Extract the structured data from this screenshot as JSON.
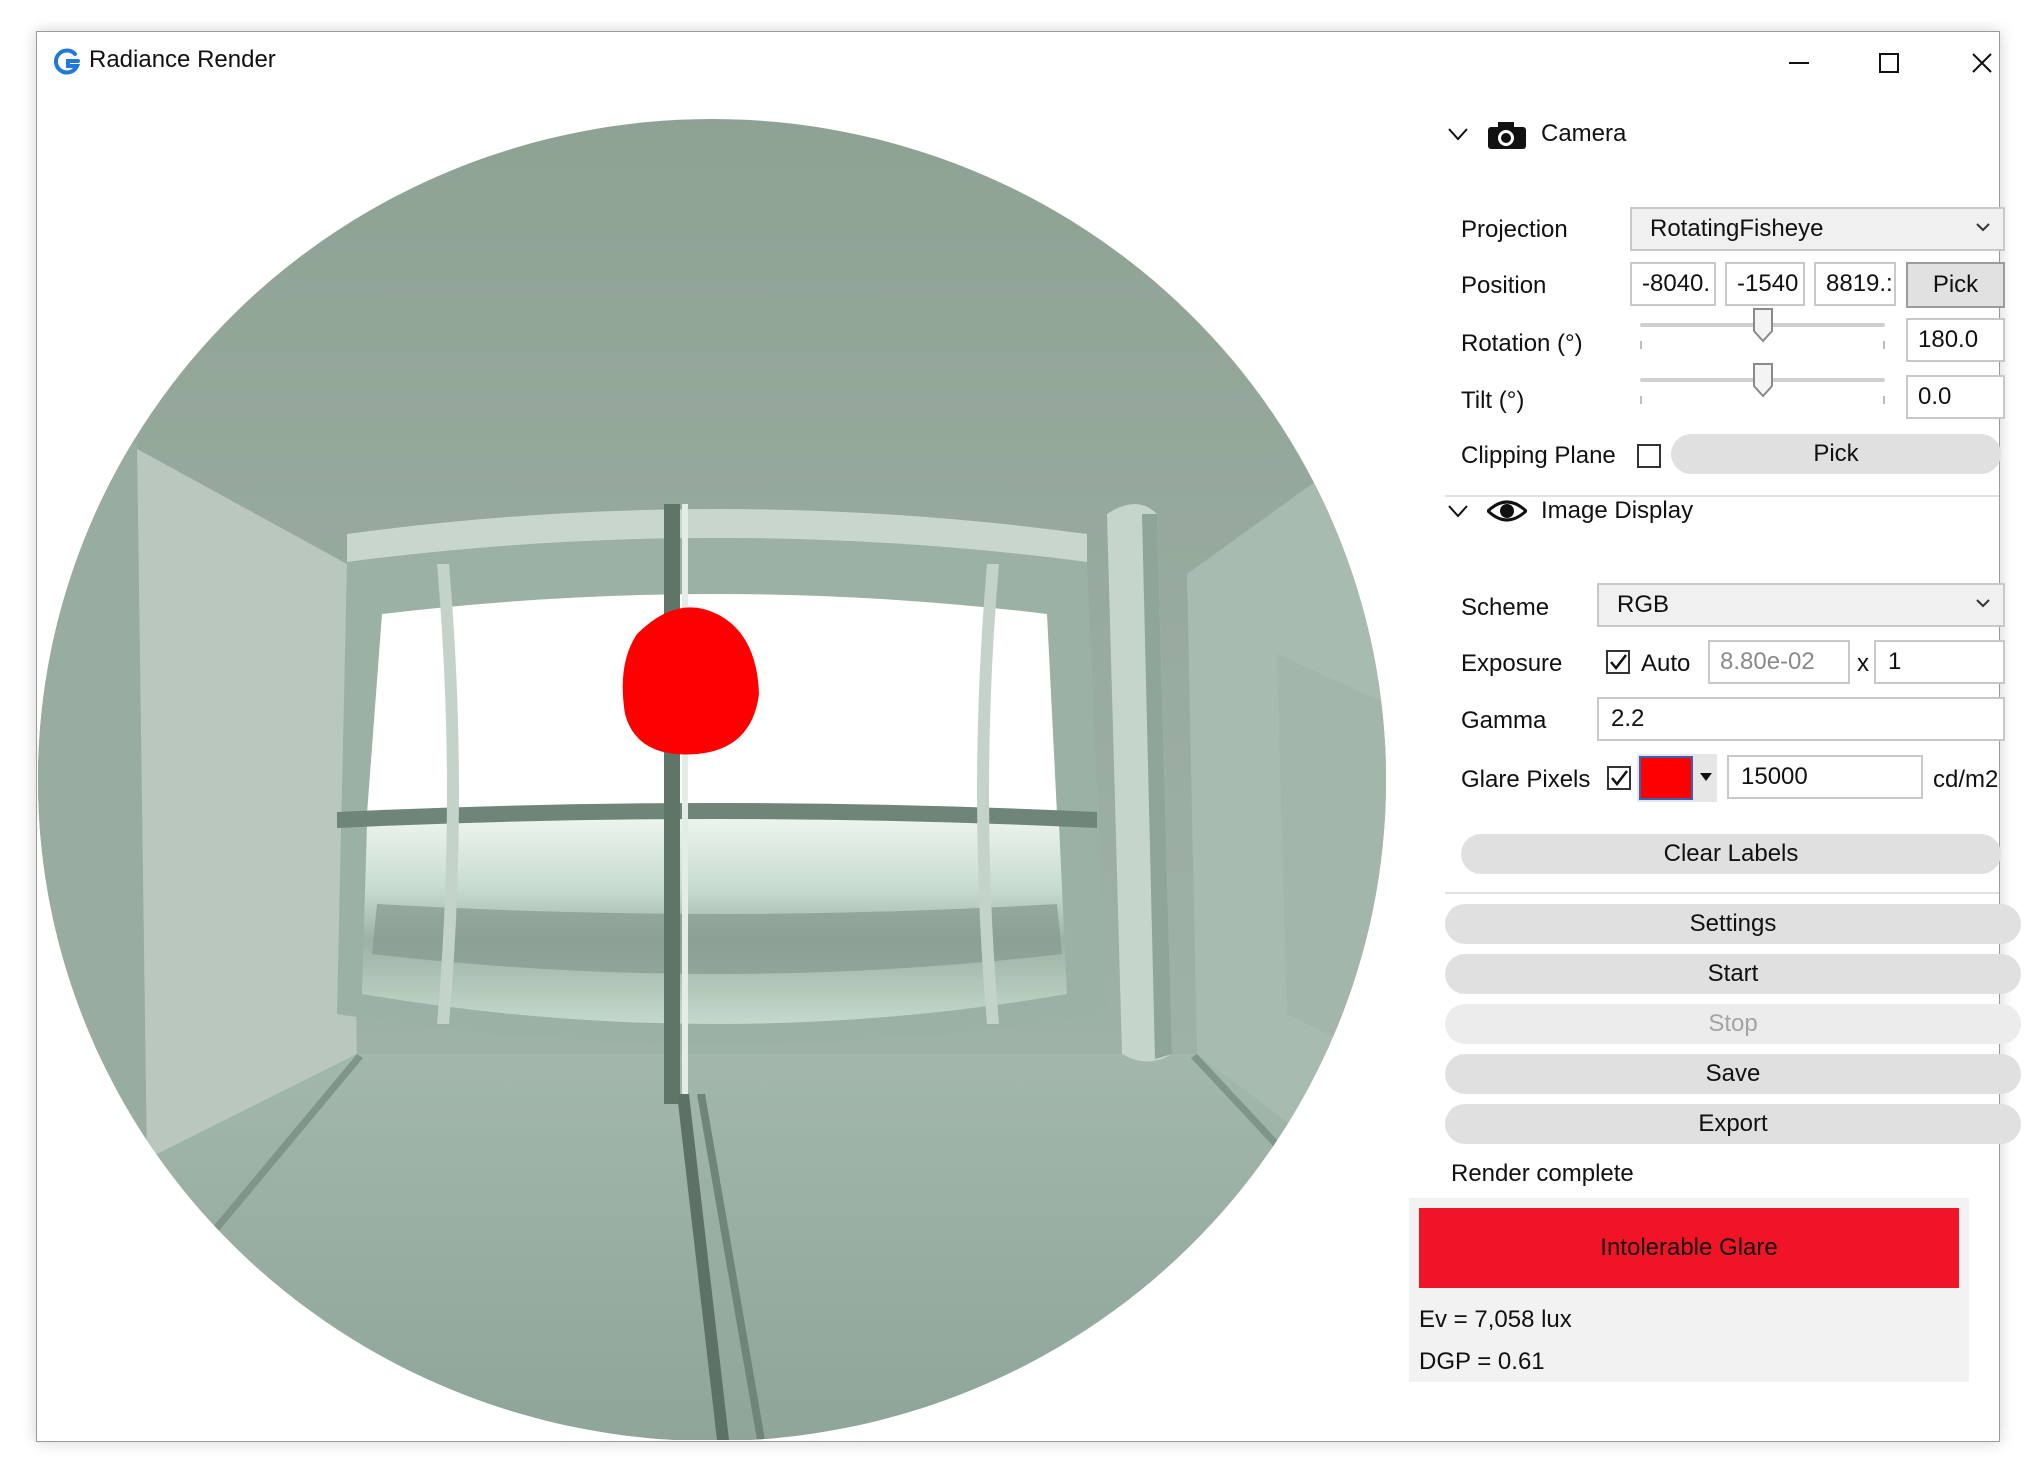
{
  "window": {
    "title": "Radiance Render"
  },
  "camera": {
    "header": "Camera",
    "projection_label": "Projection",
    "projection_value": "RotatingFisheye",
    "position_label": "Position",
    "position_x": "-8040.",
    "position_y": "-1540",
    "position_z": "8819.:",
    "pick_label": "Pick",
    "rotation_label": "Rotation (°)",
    "rotation_value": "180.0",
    "rotation_level": 0.5,
    "tilt_label": "Tilt (°)",
    "tilt_value": "0.0",
    "tilt_level": 0.5,
    "clipping_label": "Clipping Plane",
    "clipping_checked": false,
    "clipping_pick_label": "Pick"
  },
  "image_display": {
    "header": "Image Display",
    "scheme_label": "Scheme",
    "scheme_value": "RGB",
    "exposure_label": "Exposure",
    "exposure_auto_checked": true,
    "exposure_auto_label": "Auto",
    "exposure_value": "8.80e-02",
    "exposure_times": "x",
    "exposure_multiplier": "1",
    "gamma_label": "Gamma",
    "gamma_value": "2.2",
    "glare_label": "Glare Pixels",
    "glare_checked": true,
    "glare_color": "#ff0000",
    "glare_threshold": "15000",
    "glare_unit": "cd/m2",
    "clear_labels": "Clear Labels"
  },
  "actions": {
    "settings": "Settings",
    "start": "Start",
    "stop": "Stop",
    "save": "Save",
    "export": "Export"
  },
  "status": "Render complete",
  "results": {
    "glare_class": "Intolerable Glare",
    "glare_class_color": "#f01426",
    "ev": "Ev = 7,058 lux",
    "dgp": "DGP = 0.61"
  },
  "icons": {
    "app": "app-logo-icon",
    "camera": "camera-icon",
    "eye": "eye-icon"
  }
}
